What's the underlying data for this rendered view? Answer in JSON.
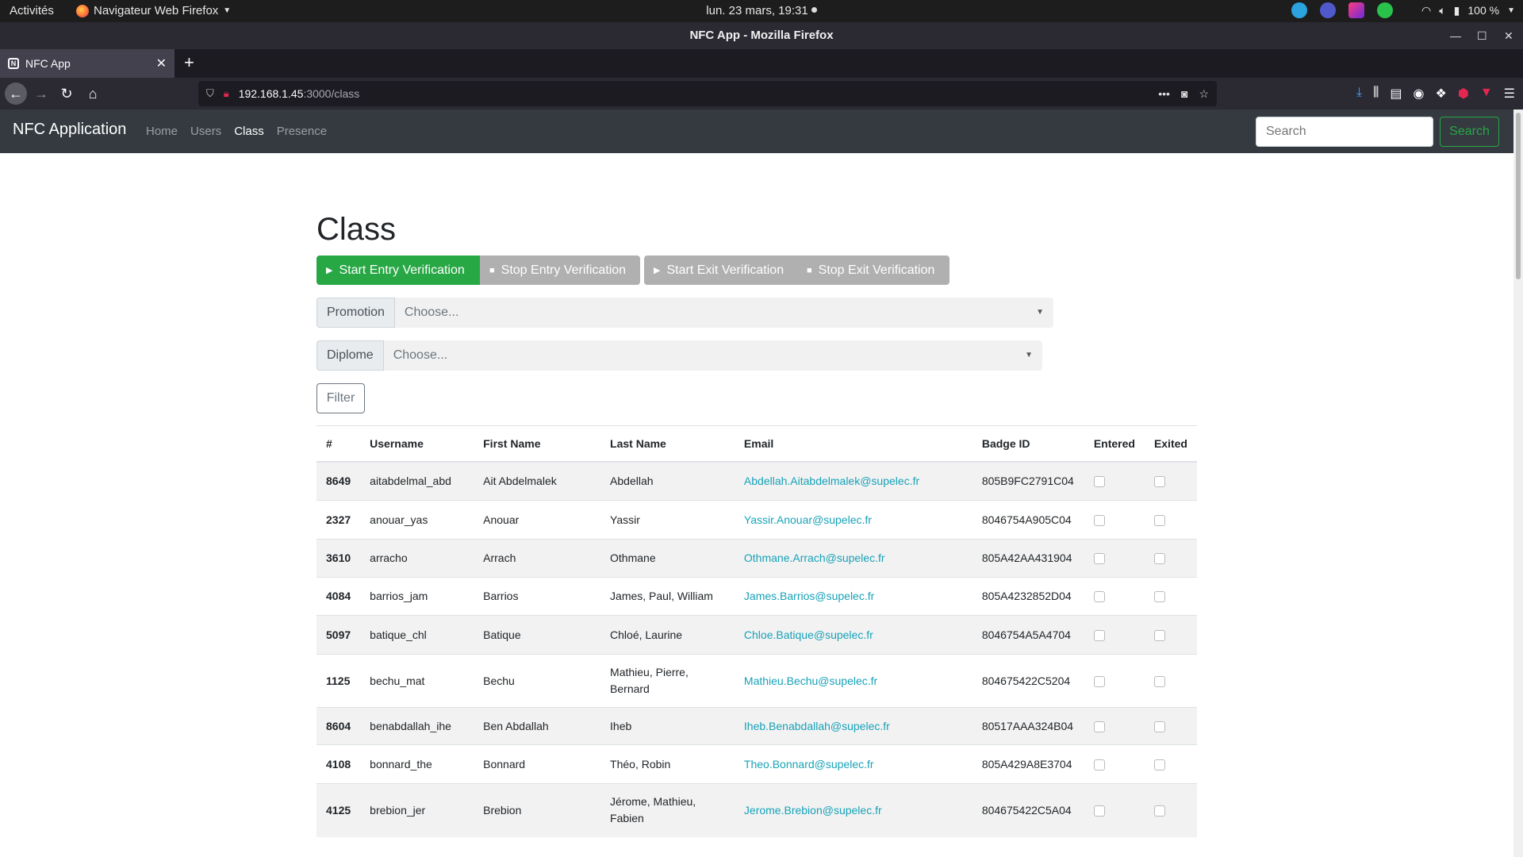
{
  "system_bar": {
    "activities": "Activités",
    "app_menu": "Navigateur Web Firefox",
    "clock": "lun. 23 mars, 19:31",
    "battery": "100 %"
  },
  "window": {
    "title": "NFC App - Mozilla Firefox"
  },
  "tab": {
    "title": "NFC App",
    "favicon": "N"
  },
  "url": {
    "host": "192.168.1.45",
    "path": ":3000/class"
  },
  "navbar": {
    "brand": "NFC Application",
    "links": [
      "Home",
      "Users",
      "Class",
      "Presence"
    ],
    "active": "Class",
    "search_placeholder": "Search",
    "search_button": "Search"
  },
  "page": {
    "title": "Class",
    "buttons": {
      "start_entry": "Start Entry Verification",
      "stop_entry": "Stop Entry Verification",
      "start_exit": "Start Exit Verification",
      "stop_exit": "Stop Exit Verification"
    },
    "promotion": {
      "label": "Promotion",
      "value": "Choose..."
    },
    "diplome": {
      "label": "Diplome",
      "value": "Choose..."
    },
    "filter_label": "Filter"
  },
  "table": {
    "headers": [
      "#",
      "Username",
      "First Name",
      "Last Name",
      "Email",
      "Badge ID",
      "Entered",
      "Exited"
    ],
    "rows": [
      {
        "id": "8649",
        "username": "aitabdelmal_abd",
        "first": "Ait Abdelmalek",
        "last": "Abdellah",
        "email": "Abdellah.Aitabdelmalek@supelec.fr",
        "badge": "805B9FC2791C04"
      },
      {
        "id": "2327",
        "username": "anouar_yas",
        "first": "Anouar",
        "last": "Yassir",
        "email": "Yassir.Anouar@supelec.fr",
        "badge": "8046754A905C04"
      },
      {
        "id": "3610",
        "username": "arracho",
        "first": "Arrach",
        "last": "Othmane",
        "email": "Othmane.Arrach@supelec.fr",
        "badge": "805A42AA431904"
      },
      {
        "id": "4084",
        "username": "barrios_jam",
        "first": "Barrios",
        "last": "James, Paul, William",
        "email": "James.Barrios@supelec.fr",
        "badge": "805A4232852D04"
      },
      {
        "id": "5097",
        "username": "batique_chl",
        "first": "Batique",
        "last": "Chloé, Laurine",
        "email": "Chloe.Batique@supelec.fr",
        "badge": "8046754A5A4704"
      },
      {
        "id": "1125",
        "username": "bechu_mat",
        "first": "Bechu",
        "last": "Mathieu, Pierre, Bernard",
        "email": "Mathieu.Bechu@supelec.fr",
        "badge": "804675422C5204"
      },
      {
        "id": "8604",
        "username": "benabdallah_ihe",
        "first": "Ben Abdallah",
        "last": "Iheb",
        "email": "Iheb.Benabdallah@supelec.fr",
        "badge": "80517AAA324B04"
      },
      {
        "id": "4108",
        "username": "bonnard_the",
        "first": "Bonnard",
        "last": "Théo, Robin",
        "email": "Theo.Bonnard@supelec.fr",
        "badge": "805A429A8E3704"
      },
      {
        "id": "4125",
        "username": "brebion_jer",
        "first": "Brebion",
        "last": "Jérome, Mathieu, Fabien",
        "email": "Jerome.Brebion@supelec.fr",
        "badge": "804675422C5A04"
      }
    ]
  },
  "colors": {
    "navbar_bg": "#343a40",
    "success": "#28a745",
    "link": "#17a2b8",
    "secondary": "#b0b0b0"
  }
}
